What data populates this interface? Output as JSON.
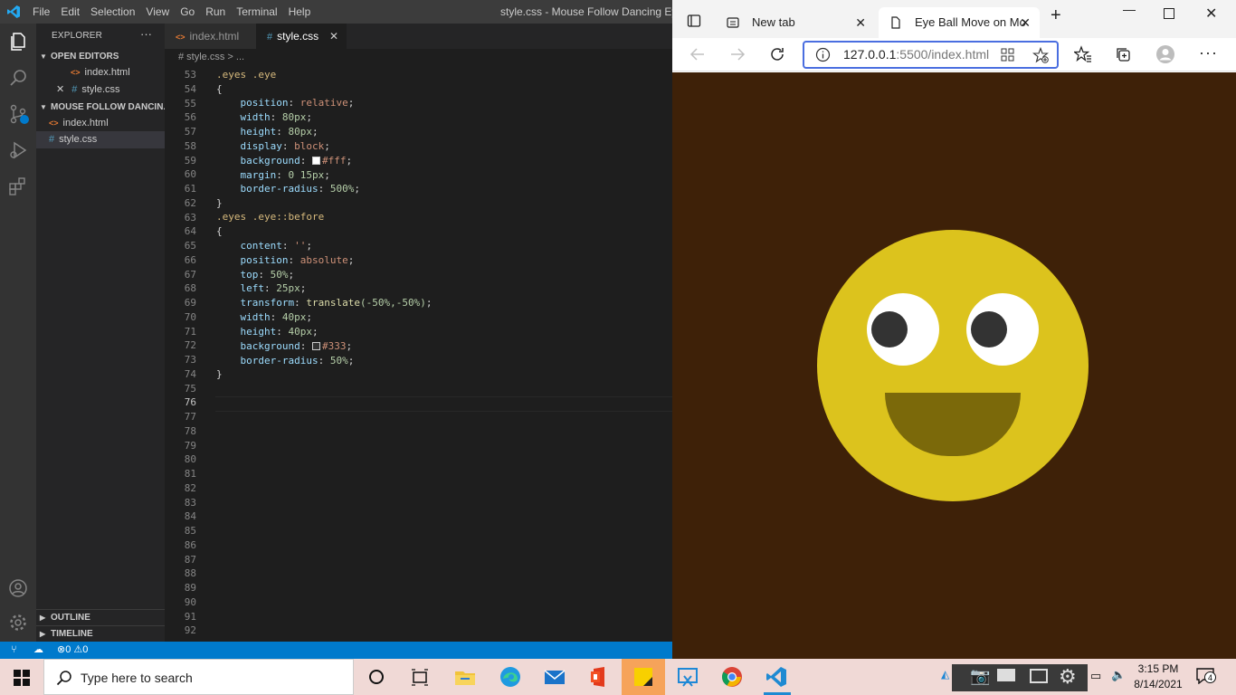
{
  "vscode": {
    "menus": [
      "File",
      "Edit",
      "Selection",
      "View",
      "Go",
      "Run",
      "Terminal",
      "Help"
    ],
    "window_title": "style.css - Mouse Follow Dancing Eyes - Vis",
    "sidebar": {
      "title": "EXPLORER",
      "more": "···",
      "open_editors": "OPEN EDITORS",
      "open_items": [
        "index.html",
        "style.css"
      ],
      "folder": "MOUSE FOLLOW DANCIN...",
      "folder_items": [
        "index.html",
        "style.css"
      ],
      "outline": "OUTLINE",
      "timeline": "TIMELINE"
    },
    "tabs": [
      {
        "label": "index.html"
      },
      {
        "label": "style.css"
      }
    ],
    "breadcrumb": "# style.css > ...",
    "line_numbers": [
      "53",
      "54",
      "55",
      "56",
      "57",
      "58",
      "59",
      "60",
      "61",
      "62",
      "63",
      "64",
      "65",
      "66",
      "67",
      "68",
      "69",
      "70",
      "71",
      "72",
      "73",
      "74",
      "75",
      "76",
      "77",
      "78",
      "79",
      "80",
      "81",
      "82",
      "83",
      "84",
      "85",
      "86",
      "87",
      "88",
      "89",
      "90",
      "91",
      "92"
    ],
    "code": {
      "l53": ".eyes .eye",
      "l54": "{",
      "l55_p": "position",
      "l55_v": "relative",
      "l56_p": "width",
      "l56_v": "80px",
      "l57_p": "height",
      "l57_v": "80px",
      "l58_p": "display",
      "l58_v": "block",
      "l59_p": "background",
      "l59_v": "#fff",
      "l60_p": "margin",
      "l60_v": "0 15px",
      "l61_p": "border-radius",
      "l61_v": "500%",
      "l62": "}",
      "l63": ".eyes .eye::before",
      "l64": "{",
      "l65_p": "content",
      "l65_v": "''",
      "l66_p": "position",
      "l66_v": "absolute",
      "l67_p": "top",
      "l67_v": "50%",
      "l68_p": "left",
      "l68_v": "25px",
      "l69_p": "transform",
      "l69_fn": "translate",
      "l69_v": "(-50%,-50%)",
      "l70_p": "width",
      "l70_v": "40px",
      "l71_p": "height",
      "l71_v": "40px",
      "l72_p": "background",
      "l72_v": "#333",
      "l73_p": "border-radius",
      "l73_v": "50%",
      "l74": "}"
    },
    "status": {
      "errors": "0",
      "warnings": "0"
    }
  },
  "browser": {
    "tabs": [
      {
        "label": "New tab"
      },
      {
        "label": "Eye Ball Move on Mo"
      }
    ],
    "url_host": "127.0.0.1",
    "url_rest": ":5500/index.html",
    "page_bg": "#3e2108",
    "face_color": "#dcc31d",
    "mouth_color": "#7b690a"
  },
  "taskbar": {
    "search_placeholder": "Type here to search",
    "time": "3:15 PM",
    "date": "8/14/2021",
    "notifications": "4"
  }
}
